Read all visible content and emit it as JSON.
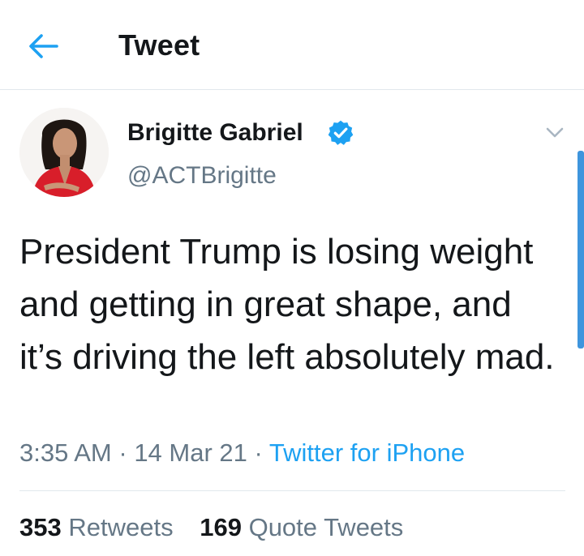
{
  "header": {
    "title": "Tweet",
    "back_icon": "arrow-left-icon"
  },
  "author": {
    "name": "Brigitte Gabriel",
    "handle": "@ACTBrigitte",
    "verified_icon": "verified-badge-icon",
    "avatar_icon": "profile-photo"
  },
  "tweet": {
    "text": "President Trump is losing weight and getting in great shape, and it’s driving the left absolutely mad.",
    "time": "3:35 AM",
    "sep1": " · ",
    "date": "14 Mar 21",
    "sep2": " · ",
    "source": "Twitter for iPhone"
  },
  "stats": {
    "retweets_count": "353",
    "retweets_label": "Retweets",
    "quotes_count": "169",
    "quotes_label": "Quote Tweets"
  },
  "colors": {
    "accent": "#1da1f2",
    "text": "#14171a",
    "muted": "#657786",
    "divider": "#e1e8ed"
  }
}
